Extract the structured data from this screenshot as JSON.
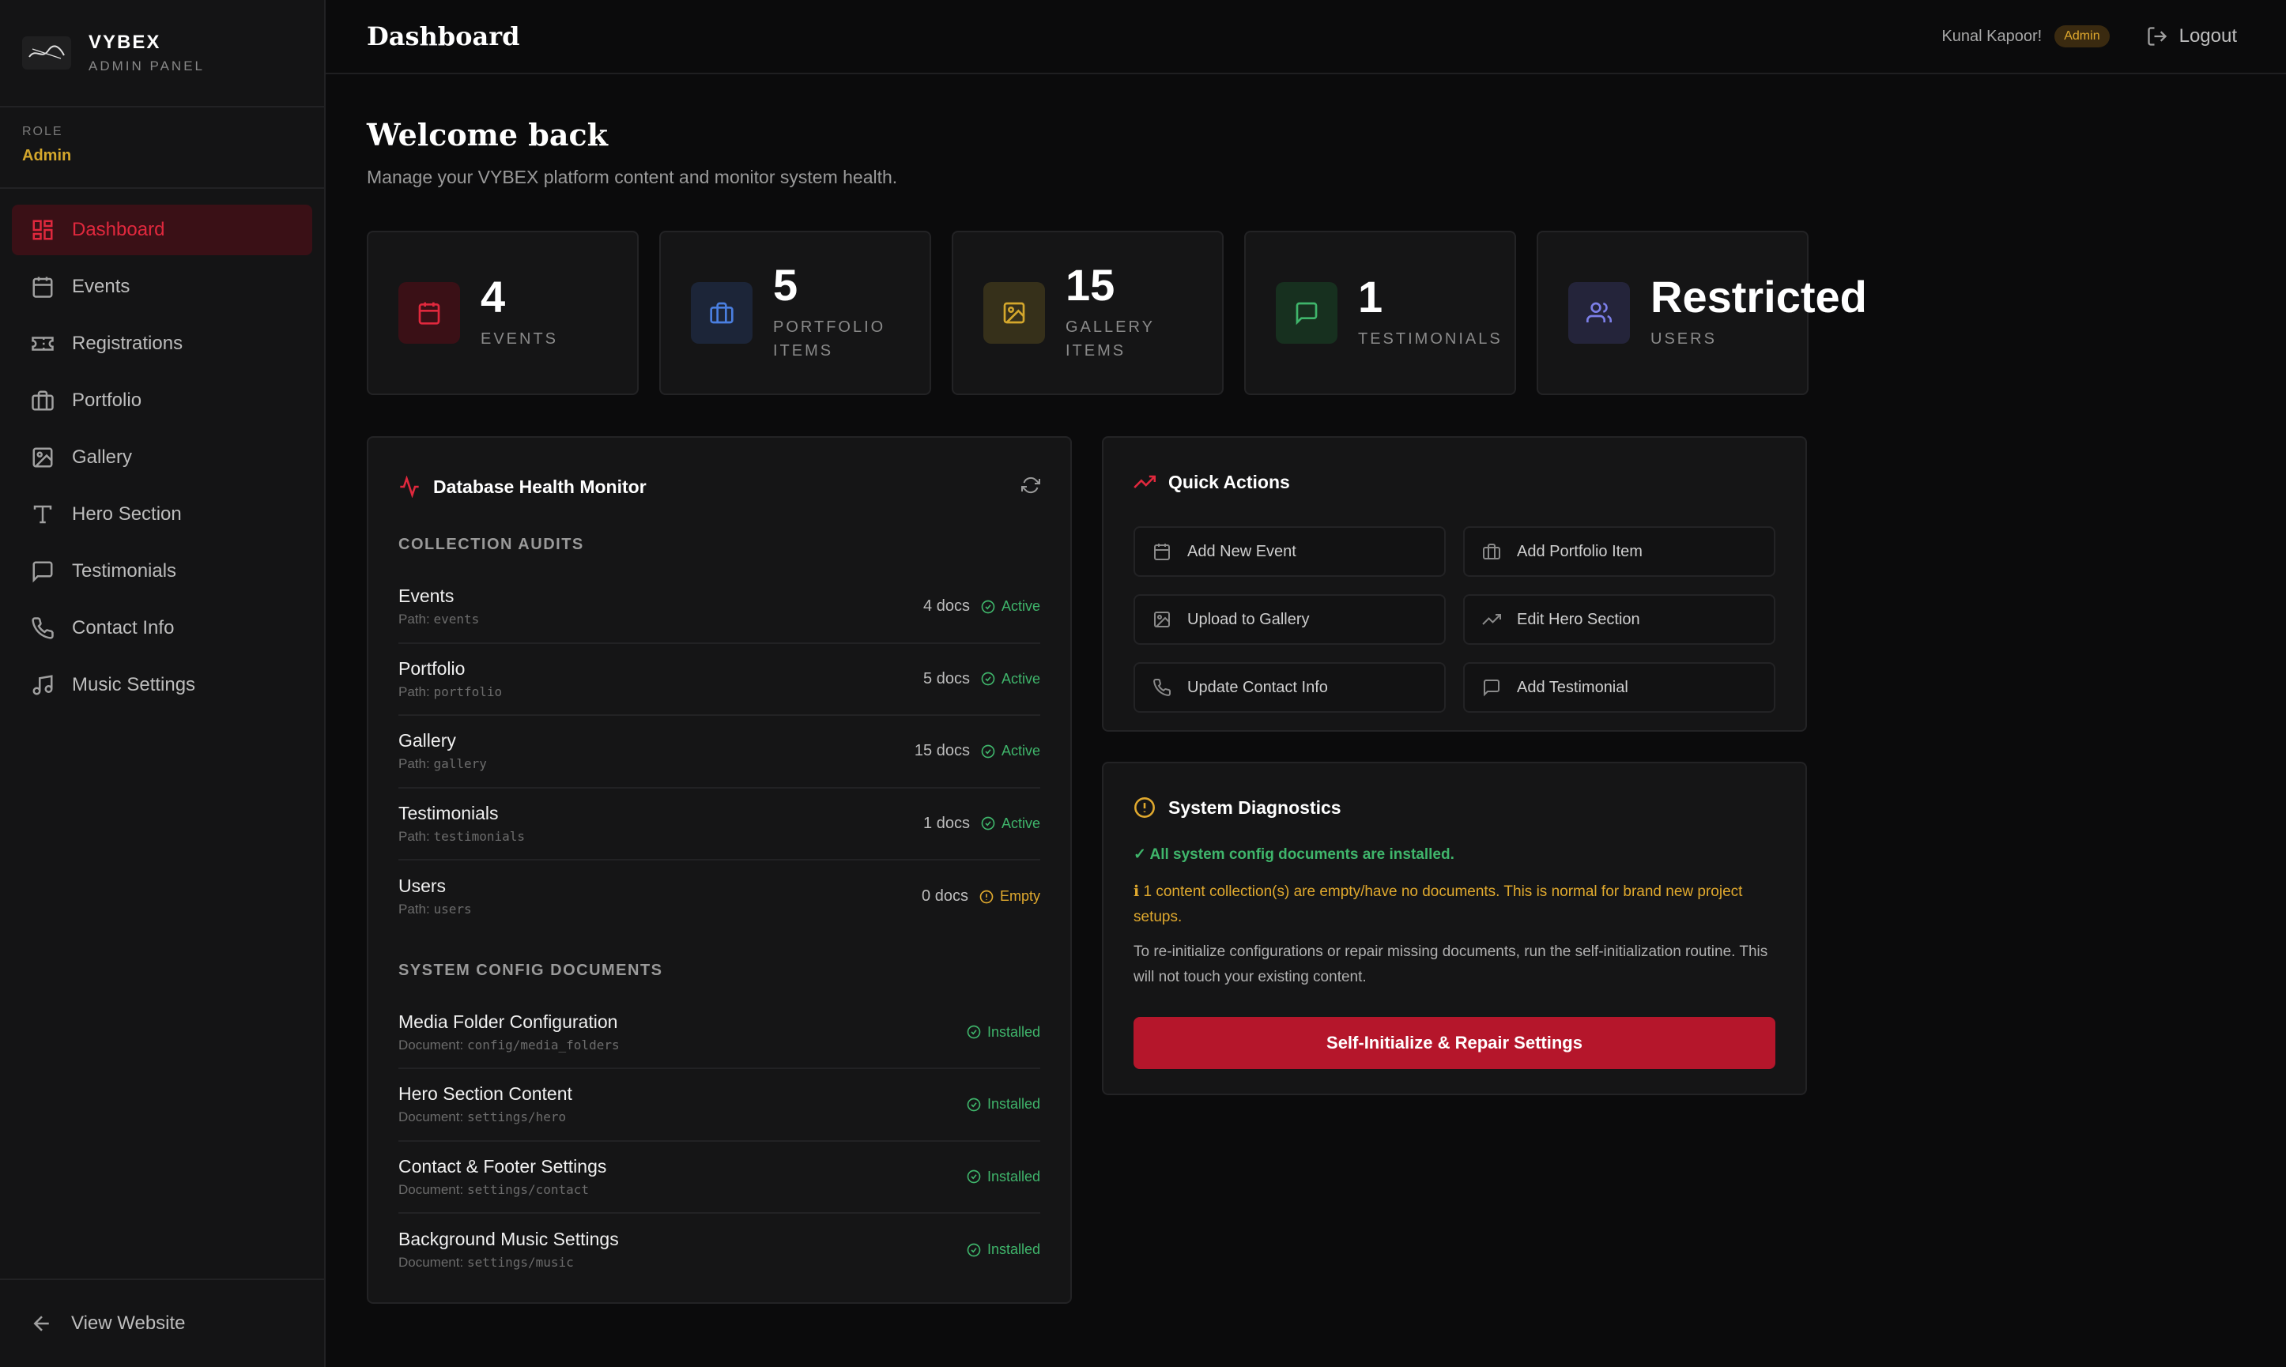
{
  "brand": {
    "name": "VYBEX",
    "subtitle": "ADMIN PANEL"
  },
  "role": {
    "label": "ROLE",
    "value": "Admin"
  },
  "nav": [
    {
      "label": "Dashboard",
      "icon": "dashboard-icon",
      "active": true
    },
    {
      "label": "Events",
      "icon": "calendar-icon"
    },
    {
      "label": "Registrations",
      "icon": "ticket-icon"
    },
    {
      "label": "Portfolio",
      "icon": "briefcase-icon"
    },
    {
      "label": "Gallery",
      "icon": "image-icon"
    },
    {
      "label": "Hero Section",
      "icon": "type-icon"
    },
    {
      "label": "Testimonials",
      "icon": "message-icon"
    },
    {
      "label": "Contact Info",
      "icon": "phone-icon"
    },
    {
      "label": "Music Settings",
      "icon": "music-icon"
    }
  ],
  "footer": {
    "view_website": "View Website"
  },
  "header": {
    "title": "Dashboard",
    "user": "Kunal Kapoor!",
    "badge": "Admin",
    "logout": "Logout"
  },
  "welcome": {
    "title": "Welcome back",
    "subtitle": "Manage your VYBEX platform content and monitor system health."
  },
  "stats": [
    {
      "value": "4",
      "label": "EVENTS",
      "color": "#e0283d"
    },
    {
      "value": "5",
      "label": "PORTFOLIO ITEMS",
      "color": "#4a7fe0"
    },
    {
      "value": "15",
      "label": "GALLERY ITEMS",
      "color": "#d4a72c"
    },
    {
      "value": "1",
      "label": "TESTIMONIALS",
      "color": "#3fb56b"
    },
    {
      "value": "Restricted",
      "label": "USERS",
      "color": "#7c7fe8"
    }
  ],
  "health": {
    "title": "Database Health Monitor",
    "collections_label": "COLLECTION AUDITS",
    "collections": [
      {
        "name": "Events",
        "path_prefix": "Path:",
        "path": "events",
        "count": "4 docs",
        "status": "Active"
      },
      {
        "name": "Portfolio",
        "path_prefix": "Path:",
        "path": "portfolio",
        "count": "5 docs",
        "status": "Active"
      },
      {
        "name": "Gallery",
        "path_prefix": "Path:",
        "path": "gallery",
        "count": "15 docs",
        "status": "Active"
      },
      {
        "name": "Testimonials",
        "path_prefix": "Path:",
        "path": "testimonials",
        "count": "1 docs",
        "status": "Active"
      },
      {
        "name": "Users",
        "path_prefix": "Path:",
        "path": "users",
        "count": "0 docs",
        "status": "Empty"
      }
    ],
    "config_label": "SYSTEM CONFIG DOCUMENTS",
    "configs": [
      {
        "name": "Media Folder Configuration",
        "doc_prefix": "Document:",
        "doc": "config/media_folders",
        "status": "Installed"
      },
      {
        "name": "Hero Section Content",
        "doc_prefix": "Document:",
        "doc": "settings/hero",
        "status": "Installed"
      },
      {
        "name": "Contact & Footer Settings",
        "doc_prefix": "Document:",
        "doc": "settings/contact",
        "status": "Installed"
      },
      {
        "name": "Background Music Settings",
        "doc_prefix": "Document:",
        "doc": "settings/music",
        "status": "Installed"
      }
    ]
  },
  "quick_actions": {
    "title": "Quick Actions",
    "items": [
      {
        "label": "Add New Event",
        "icon": "calendar-icon"
      },
      {
        "label": "Add Portfolio Item",
        "icon": "briefcase-icon"
      },
      {
        "label": "Upload to Gallery",
        "icon": "image-icon"
      },
      {
        "label": "Edit Hero Section",
        "icon": "trending-icon"
      },
      {
        "label": "Update Contact Info",
        "icon": "phone-icon"
      },
      {
        "label": "Add Testimonial",
        "icon": "message-icon"
      }
    ]
  },
  "diagnostics": {
    "title": "System Diagnostics",
    "ok": "✓ All system config documents are installed.",
    "warn": "ℹ 1 content collection(s) are empty/have no documents. This is normal for brand new project setups.",
    "text": "To re-initialize configurations or repair missing documents, run the self-initialization routine. This will not touch your existing content.",
    "button": "Self-Initialize & Repair Settings"
  }
}
